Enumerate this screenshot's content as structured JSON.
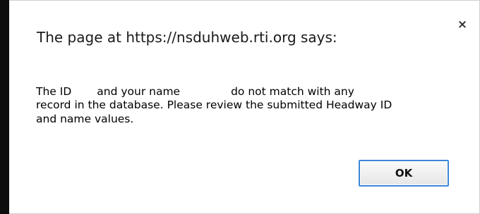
{
  "dialog": {
    "title": "The page at https://nsduhweb.rti.org says:",
    "close_glyph": "×",
    "message": {
      "part1": "The ID",
      "part2": "and your name",
      "part3": "do not match with any",
      "line2": "record in the database. Please review the submitted Headway ID",
      "line3": "and name values."
    },
    "ok_label": "OK"
  },
  "colors": {
    "focus_border": "#3d86d6",
    "left_edge": "#0d0d0d"
  }
}
